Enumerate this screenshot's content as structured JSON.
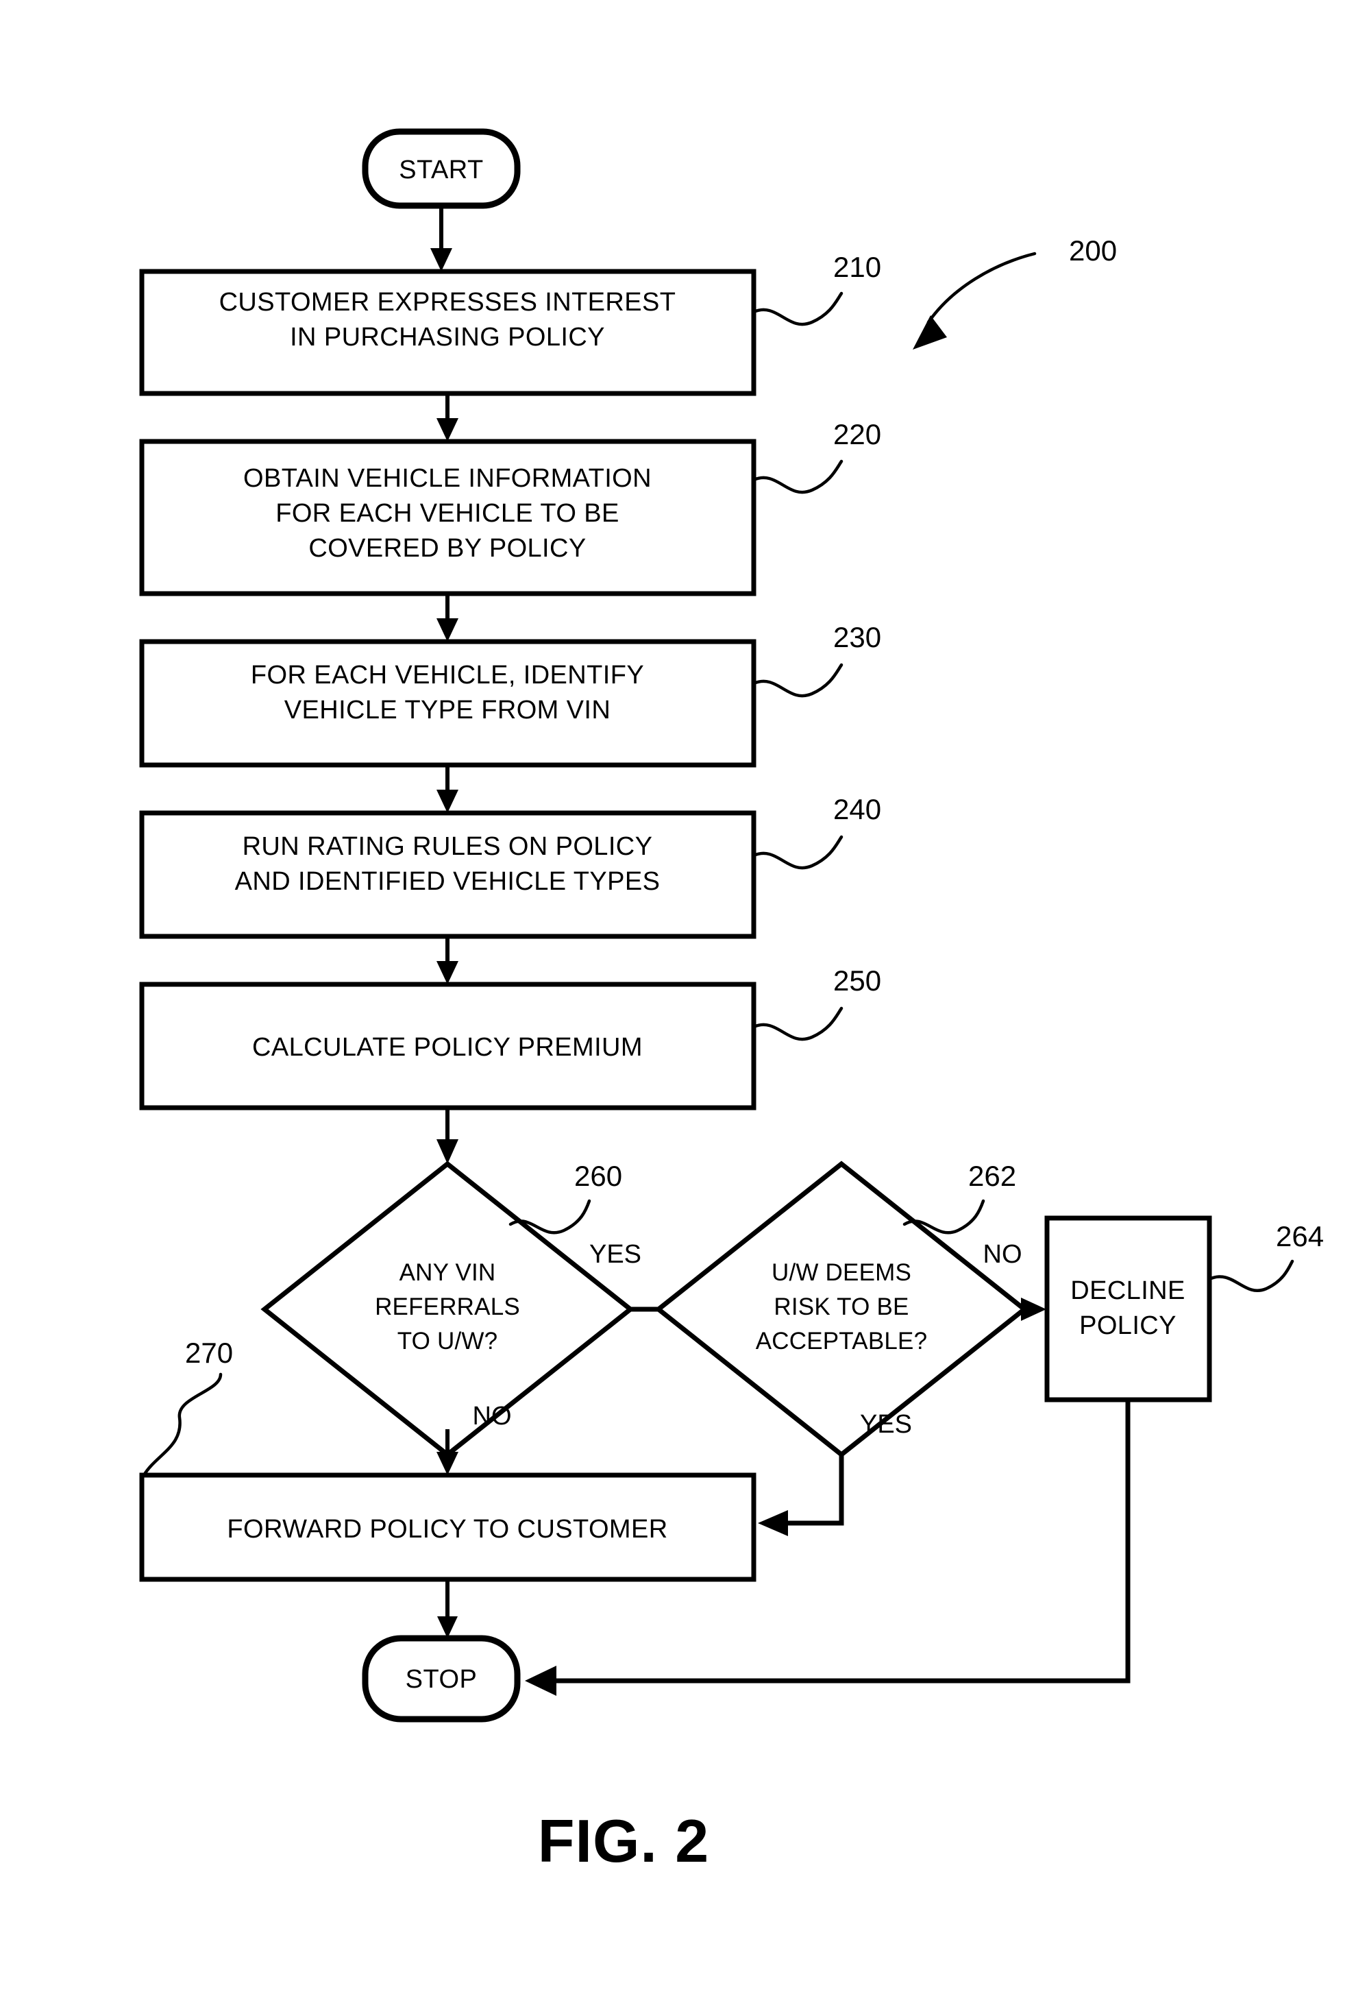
{
  "figure": {
    "caption": "FIG. 2",
    "diagram_ref": "200",
    "type": "flowchart",
    "orientation": "vertical"
  },
  "nodes": {
    "start": {
      "label": "START",
      "shape": "terminator",
      "ref": ""
    },
    "n210": {
      "ref": "210",
      "shape": "process",
      "line1": "CUSTOMER EXPRESSES INTEREST",
      "line2": "IN PURCHASING POLICY",
      "line3": ""
    },
    "n220": {
      "ref": "220",
      "shape": "process",
      "line1": "OBTAIN VEHICLE INFORMATION",
      "line2": "FOR EACH VEHICLE TO BE",
      "line3": "COVERED BY POLICY"
    },
    "n230": {
      "ref": "230",
      "shape": "process",
      "line1": "FOR EACH VEHICLE, IDENTIFY",
      "line2": "VEHICLE TYPE FROM VIN",
      "line3": ""
    },
    "n240": {
      "ref": "240",
      "shape": "process",
      "line1": "RUN RATING RULES ON POLICY",
      "line2": "AND IDENTIFIED VEHICLE TYPES",
      "line3": ""
    },
    "n250": {
      "ref": "250",
      "shape": "process",
      "line1": "CALCULATE POLICY PREMIUM",
      "line2": "",
      "line3": ""
    },
    "n260": {
      "ref": "260",
      "shape": "decision",
      "line1": "ANY VIN",
      "line2": "REFERRALS",
      "line3": "TO U/W?"
    },
    "n262": {
      "ref": "262",
      "shape": "decision",
      "line1": "U/W DEEMS",
      "line2": "RISK TO BE",
      "line3": "ACCEPTABLE?"
    },
    "n264": {
      "ref": "264",
      "shape": "process",
      "line1": "DECLINE",
      "line2": "POLICY",
      "line3": ""
    },
    "n270": {
      "ref": "270",
      "shape": "process",
      "line1": "FORWARD POLICY TO CUSTOMER",
      "line2": "",
      "line3": ""
    },
    "stop": {
      "label": "STOP",
      "shape": "terminator",
      "ref": ""
    }
  },
  "edge_labels": {
    "e260_yes": "YES",
    "e260_no": "NO",
    "e262_no": "NO",
    "e262_yes": "YES"
  },
  "colors": {
    "ink": "#000000",
    "paper": "#ffffff"
  }
}
